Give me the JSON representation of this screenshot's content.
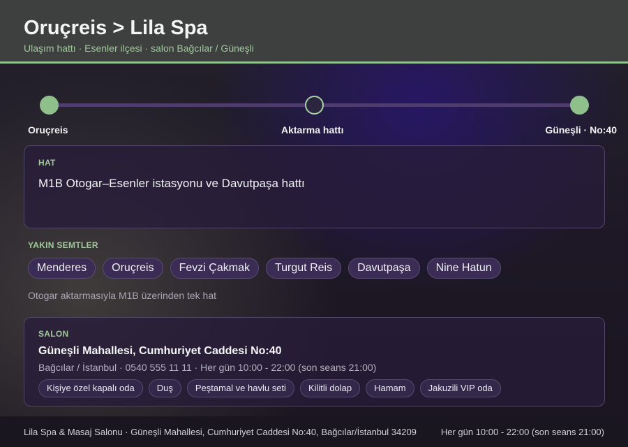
{
  "header": {
    "title": "Oruçreis > Lila Spa",
    "subtitle": "Ulaşım hattı · Esenler ilçesi · salon Bağcılar / Güneşli"
  },
  "route": {
    "stops": [
      {
        "label": "Oruçreis"
      },
      {
        "label": "Aktarma hattı"
      },
      {
        "label": "Güneşli · No:40"
      }
    ]
  },
  "line_card": {
    "label": "HAT",
    "text": "M1B Otogar–Esenler istasyonu ve Davutpaşa hattı"
  },
  "nearby": {
    "label": "YAKIN SEMTLER",
    "items": [
      "Menderes",
      "Oruçreis",
      "Fevzi Çakmak",
      "Turgut Reis",
      "Davutpaşa",
      "Nine Hatun"
    ],
    "note": "Otogar aktarmasıyla M1B üzerinden tek hat"
  },
  "salon": {
    "label": "SALON",
    "address": "Güneşli Mahallesi, Cumhuriyet Caddesi No:40",
    "meta": "Bağcılar / İstanbul · 0540 555 11 11 · Her gün 10:00 - 22:00 (son seans 21:00)",
    "features": [
      "Kişiye özel kapalı oda",
      "Duş",
      "Peştamal ve havlu seti",
      "Kilitli dolap",
      "Hamam",
      "Jakuzili VIP oda"
    ]
  },
  "footer": {
    "left": "Lila Spa & Masaj Salonu · Güneşli Mahallesi, Cumhuriyet Caddesi No:40, Bağcılar/İstanbul 34209",
    "right": "Her gün 10:00 - 22:00 (son seans 21:00)"
  },
  "colors": {
    "accent_green": "#93c08f",
    "header_bg": "#3d403f",
    "card_bg": "#281c3a",
    "chip_bg": "#3a2c54"
  }
}
